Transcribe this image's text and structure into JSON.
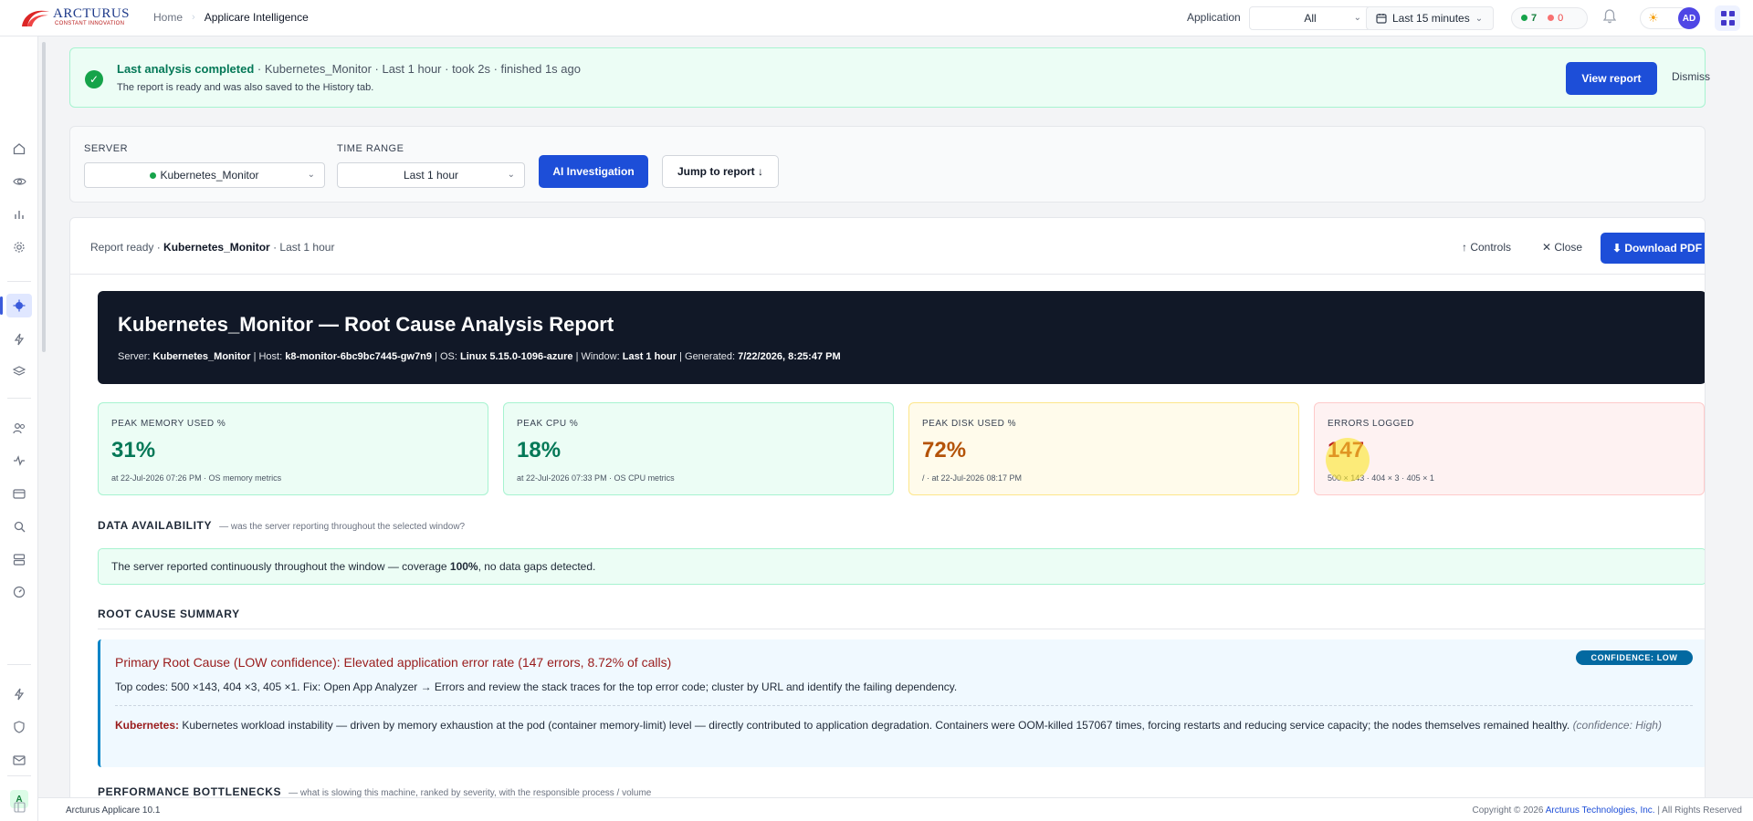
{
  "header": {
    "logo_text": "ARCTURUS",
    "logo_subtext": "CONSTANT INNOVATION",
    "breadcrumb_home": "Home",
    "breadcrumb_current": "Applicare Intelligence",
    "application_label": "Application",
    "application_value": "All",
    "time_range": "Last 15 minutes",
    "status_green_count": "7",
    "status_red_count": "0",
    "avatar_initials": "AD"
  },
  "sidebar": {
    "bottom_badge": "A"
  },
  "banner": {
    "title": "Last analysis completed",
    "meta": "· Kubernetes_Monitor · Last 1 hour · took 2s · finished 1s ago",
    "subtitle": "The report is ready and was also saved to the History tab.",
    "view_button": "View report",
    "dismiss_button": "Dismiss"
  },
  "controls": {
    "server_label": "SERVER",
    "server_value": "Kubernetes_Monitor",
    "time_label": "TIME RANGE",
    "time_value": "Last 1 hour",
    "ai_button": "AI Investigation",
    "jump_button": "Jump to report ↓"
  },
  "report_bar": {
    "status_prefix": "Report ready ·",
    "server": "Kubernetes_Monitor",
    "window": "· Last 1 hour",
    "controls_button": "↑ Controls",
    "close_button": "✕ Close",
    "pdf_button": "⬇ Download PDF"
  },
  "report": {
    "title": "Kubernetes_Monitor — Root Cause Analysis Report",
    "server_label": "Server:",
    "server": "Kubernetes_Monitor",
    "host_label": "| Host:",
    "host": "k8-monitor-6bc9bc7445-gw7n9",
    "os_label": "| OS:",
    "os": "Linux 5.15.0-1096-azure",
    "window_label": "| Window:",
    "window": "Last 1 hour",
    "generated_label": "| Generated:",
    "generated": "7/22/2026, 8:25:47 PM"
  },
  "cards": [
    {
      "label": "PEAK MEMORY USED %",
      "value": "31%",
      "sub": "at 22-Jul-2026 07:26 PM · OS memory metrics"
    },
    {
      "label": "PEAK CPU %",
      "value": "18%",
      "sub": "at 22-Jul-2026 07:33 PM · OS CPU metrics"
    },
    {
      "label": "PEAK DISK USED %",
      "value": "72%",
      "sub": "/ · at 22-Jul-2026 08:17 PM"
    },
    {
      "label": "ERRORS LOGGED",
      "value": "147",
      "sub": "500 × 143 · 404 × 3 · 405 × 1"
    }
  ],
  "availability": {
    "title": "DATA AVAILABILITY",
    "note": "— was the server reporting throughout the selected window?",
    "text_before": "The server reported continuously throughout the window — coverage",
    "coverage": "100%",
    "text_after": ", no data gaps detected."
  },
  "root_cause": {
    "section_title": "ROOT CAUSE SUMMARY",
    "primary": "Primary Root Cause (LOW confidence): Elevated application error rate (147 errors, 8.72% of calls)",
    "badge": "CONFIDENCE: LOW",
    "codes": "Top codes: 500 ×143, 404 ×3, 405 ×1. Fix: Open App Analyzer → Errors and review the stack traces for the top error code; cluster by URL and identify the failing dependency.",
    "k8s_label": "Kubernetes:",
    "k8s_text": "Kubernetes workload instability — driven by memory exhaustion at the pod (container memory-limit) level — directly contributed to application degradation. Containers were OOM-killed 157067 times, forcing restarts and reducing service capacity; the nodes themselves remained healthy.",
    "k8s_confidence": "(confidence: High)"
  },
  "performance": {
    "title": "PERFORMANCE BOTTLENECKS",
    "note": "— what is slowing this machine, ranked by severity, with the responsible process / volume"
  },
  "footer": {
    "version": "Arcturus Applicare 10.1",
    "copyright_prefix": "Copyright © 2026",
    "company": "Arcturus Technologies, Inc.",
    "rights": "| All Rights Reserved"
  },
  "colors": {
    "primary_blue": "#1d4ed8",
    "success_green": "#16a34a",
    "error_red": "#b91c1c",
    "warning_amber": "#b45309",
    "hero_dark": "#111827"
  }
}
